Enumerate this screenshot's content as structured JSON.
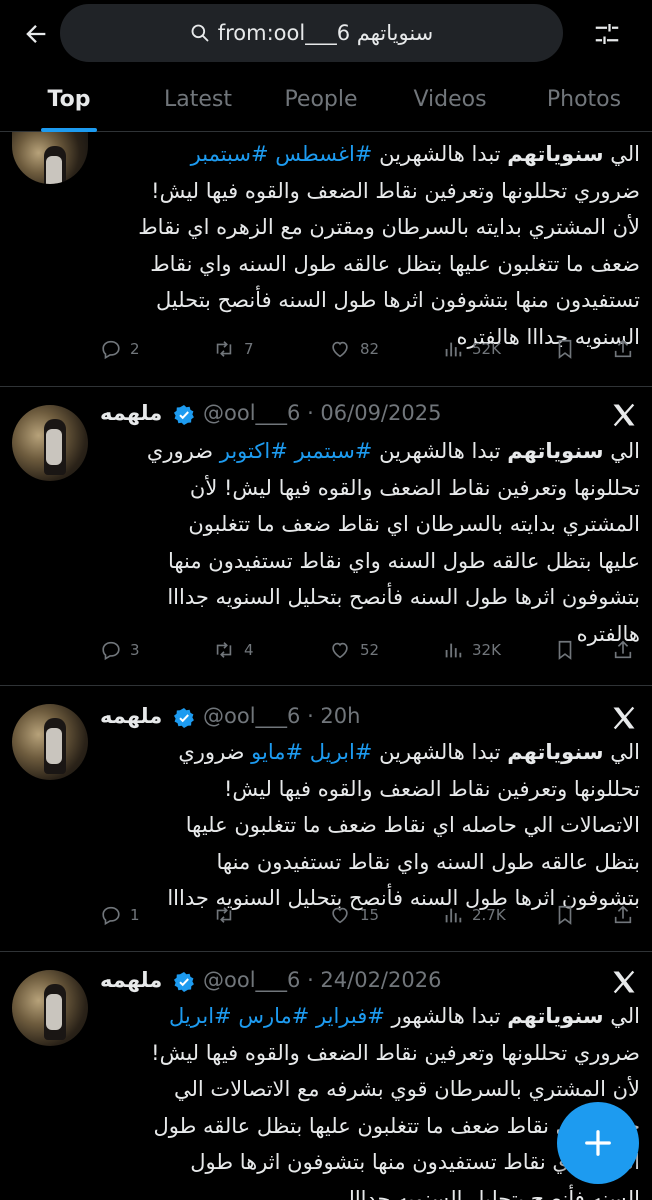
{
  "search": {
    "query": "from:ool___6 سنوياتهم"
  },
  "tabs": [
    {
      "label": "Top",
      "active": true
    },
    {
      "label": "Latest",
      "active": false
    },
    {
      "label": "People",
      "active": false
    },
    {
      "label": "Videos",
      "active": false
    },
    {
      "label": "Photos",
      "active": false
    }
  ],
  "tweets": [
    {
      "name": "",
      "handle": "",
      "lines": [
        [
          "الي ",
          "سنوياتهم",
          " تبدا هالشهرين ",
          "#اغسطس #سبتمبر"
        ],
        "ضروري تحللونها وتعرفين نقاط الضعف والقوه فيها ليش!",
        "لأن المشتري بدايته بالسرطان ومقترن مع الزهره اي نقاط",
        "ضعف ما تتغلبون عليها بتظل عالقه طول السنه واي نقاط",
        "تستفيدون منها بتشوفون اثرها طول السنه فأنصح بتحليل",
        "السنويه جدااا هالفتره"
      ],
      "replies": "2",
      "reposts": "7",
      "likes": "82",
      "views": "52K"
    },
    {
      "name": "ملهمه",
      "handle": "@ool___6 · 06/09/2025",
      "lines": [
        [
          "الي ",
          "سنوياتهم",
          " تبدا هالشهرين ",
          "#سبتمبر #اكتوبر",
          " ضروري"
        ],
        "تحللونها وتعرفين نقاط الضعف والقوه فيها ليش! لأن",
        "المشتري بدايته بالسرطان  اي نقاط ضعف ما تتغلبون",
        "عليها بتظل عالقه طول السنه واي نقاط تستفيدون منها",
        "بتشوفون اثرها طول السنه فأنصح بتحليل السنويه جدااا",
        "هالفتره"
      ],
      "replies": "3",
      "reposts": "4",
      "likes": "52",
      "views": "32K"
    },
    {
      "name": "ملهمه",
      "handle": "@ool___6 · 20h",
      "lines": [
        [
          "الي ",
          "سنوياتهم",
          " تبدا هالشهرين ",
          "#ابريل #مايو",
          " ضروري"
        ],
        "تحللونها وتعرفين نقاط الضعف والقوه فيها ليش!",
        "الاتصالات الي حاصله اي نقاط ضعف ما تتغلبون عليها",
        "بتظل عالقه طول السنه واي نقاط تستفيدون منها",
        "بتشوفون اثرها طول السنه فأنصح بتحليل السنويه جدااا"
      ],
      "replies": "1",
      "reposts": "",
      "likes": "15",
      "views": "2.7K"
    },
    {
      "name": "ملهمه",
      "handle": "@ool___6 · 24/02/2026",
      "lines": [
        [
          "الي ",
          "سنوياتهم",
          " تبدا هالشهور ",
          "#فبراير #مارس #ابريل"
        ],
        "ضروري تحللونها وتعرفين نقاط الضعف والقوه فيها ليش!",
        "لأن المشتري بالسرطان قوي بشرفه مع الاتصالات الي",
        "حاصله اي نقاط ضعف ما تتغلبون عليها بتظل عالقه طول",
        "السنه واي نقاط تستفيدون منها بتشوفون اثرها طول",
        "السنه فأنصح بتحليل السنويه جدااا"
      ],
      "replies": "",
      "reposts": "",
      "likes": "",
      "views": ""
    }
  ],
  "icons": {
    "back": "arrow-left-icon",
    "search": "search-icon",
    "filter": "sliders-icon",
    "x_logo": "x-logo-icon",
    "verified": "verified-badge-icon",
    "compose": "plus-icon"
  },
  "colors": {
    "accent": "#1d9bf0",
    "background": "#000000",
    "muted": "#71767b",
    "text": "#e7e9ea"
  }
}
